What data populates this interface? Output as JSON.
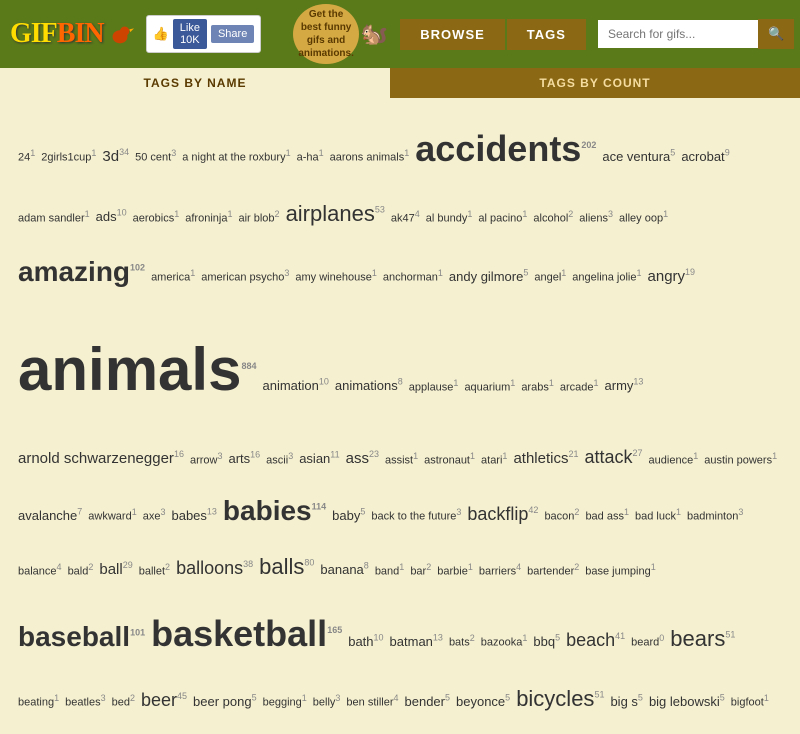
{
  "header": {
    "logo_gif": "GIF",
    "logo_bin": "BIN",
    "like_text": "Like 10K",
    "share_text": "Share",
    "banner_text": "Get the best funny gifs and animations.",
    "browse_label": "BROWSE",
    "tags_label": "TAGS",
    "search_placeholder": "Search for gifs..."
  },
  "tabs": {
    "by_name_label": "TAGS BY NAME",
    "by_count_label": "TAGS BY COUNT"
  },
  "tags": [
    {
      "text": "24",
      "count": "1",
      "size": 1
    },
    {
      "text": "2girls1cup",
      "count": "1",
      "size": 1
    },
    {
      "text": "3d",
      "count": "34",
      "size": 3
    },
    {
      "text": "50 cent",
      "count": "3",
      "size": 1
    },
    {
      "text": "a night at the roxbury",
      "count": "1",
      "size": 1
    },
    {
      "text": "a-ha",
      "count": "1",
      "size": 1
    },
    {
      "text": "aarons animals",
      "count": "1",
      "size": 1
    },
    {
      "text": "accidents",
      "count": "202",
      "size": 7
    },
    {
      "text": "ace ventura",
      "count": "5",
      "size": 2
    },
    {
      "text": "acrobat",
      "count": "9",
      "size": 2
    },
    {
      "text": "adam sandler",
      "count": "1",
      "size": 1
    },
    {
      "text": "ads",
      "count": "10",
      "size": 2
    },
    {
      "text": "aerobics",
      "count": "1",
      "size": 1
    },
    {
      "text": "afroninja",
      "count": "1",
      "size": 1
    },
    {
      "text": "air blob",
      "count": "2",
      "size": 1
    },
    {
      "text": "airplanes",
      "count": "53",
      "size": 5
    },
    {
      "text": "ak47",
      "count": "4",
      "size": 1
    },
    {
      "text": "al bundy",
      "count": "1",
      "size": 1
    },
    {
      "text": "al pacino",
      "count": "1",
      "size": 1
    },
    {
      "text": "alcohol",
      "count": "2",
      "size": 1
    },
    {
      "text": "aliens",
      "count": "3",
      "size": 1
    },
    {
      "text": "alley oop",
      "count": "1",
      "size": 1
    },
    {
      "text": "amazing",
      "count": "102",
      "size": 6
    },
    {
      "text": "america",
      "count": "1",
      "size": 1
    },
    {
      "text": "american psycho",
      "count": "3",
      "size": 1
    },
    {
      "text": "amy winehouse",
      "count": "1",
      "size": 1
    },
    {
      "text": "anchorman",
      "count": "1",
      "size": 1
    },
    {
      "text": "andy gilmore",
      "count": "5",
      "size": 2
    },
    {
      "text": "angel",
      "count": "1",
      "size": 1
    },
    {
      "text": "angelina jolie",
      "count": "1",
      "size": 1
    },
    {
      "text": "angry",
      "count": "19",
      "size": 3
    },
    {
      "text": "animals",
      "count": "884",
      "size": 9
    },
    {
      "text": "animation",
      "count": "10",
      "size": 2
    },
    {
      "text": "animations",
      "count": "8",
      "size": 2
    },
    {
      "text": "applause",
      "count": "1",
      "size": 1
    },
    {
      "text": "aquarium",
      "count": "1",
      "size": 1
    },
    {
      "text": "arabs",
      "count": "1",
      "size": 1
    },
    {
      "text": "arcade",
      "count": "1",
      "size": 1
    },
    {
      "text": "army",
      "count": "13",
      "size": 2
    },
    {
      "text": "arnold schwarzenegger",
      "count": "16",
      "size": 3
    },
    {
      "text": "arrow",
      "count": "3",
      "size": 1
    },
    {
      "text": "arts",
      "count": "16",
      "size": 2
    },
    {
      "text": "ascii",
      "count": "3",
      "size": 1
    },
    {
      "text": "asian",
      "count": "11",
      "size": 2
    },
    {
      "text": "ass",
      "count": "23",
      "size": 3
    },
    {
      "text": "assist",
      "count": "1",
      "size": 1
    },
    {
      "text": "astronaut",
      "count": "1",
      "size": 1
    },
    {
      "text": "atari",
      "count": "1",
      "size": 1
    },
    {
      "text": "athletics",
      "count": "21",
      "size": 3
    },
    {
      "text": "attack",
      "count": "27",
      "size": 4
    },
    {
      "text": "audience",
      "count": "1",
      "size": 1
    },
    {
      "text": "austin powers",
      "count": "1",
      "size": 1
    },
    {
      "text": "avalanche",
      "count": "7",
      "size": 2
    },
    {
      "text": "awkward",
      "count": "1",
      "size": 1
    },
    {
      "text": "axe",
      "count": "3",
      "size": 1
    },
    {
      "text": "babes",
      "count": "13",
      "size": 2
    },
    {
      "text": "babies",
      "count": "114",
      "size": 6
    },
    {
      "text": "baby",
      "count": "5",
      "size": 2
    },
    {
      "text": "back to the future",
      "count": "3",
      "size": 1
    },
    {
      "text": "backflip",
      "count": "42",
      "size": 4
    },
    {
      "text": "bacon",
      "count": "2",
      "size": 1
    },
    {
      "text": "bad ass",
      "count": "1",
      "size": 1
    },
    {
      "text": "bad luck",
      "count": "1",
      "size": 1
    },
    {
      "text": "badminton",
      "count": "3",
      "size": 1
    },
    {
      "text": "balance",
      "count": "4",
      "size": 1
    },
    {
      "text": "bald",
      "count": "2",
      "size": 1
    },
    {
      "text": "ball",
      "count": "29",
      "size": 3
    },
    {
      "text": "ballet",
      "count": "2",
      "size": 1
    },
    {
      "text": "balloons",
      "count": "38",
      "size": 4
    },
    {
      "text": "balls",
      "count": "80",
      "size": 5
    },
    {
      "text": "banana",
      "count": "8",
      "size": 2
    },
    {
      "text": "band",
      "count": "1",
      "size": 1
    },
    {
      "text": "bar",
      "count": "2",
      "size": 1
    },
    {
      "text": "barbie",
      "count": "1",
      "size": 1
    },
    {
      "text": "barriers",
      "count": "4",
      "size": 1
    },
    {
      "text": "bartender",
      "count": "2",
      "size": 1
    },
    {
      "text": "base jumping",
      "count": "1",
      "size": 1
    },
    {
      "text": "baseball",
      "count": "101",
      "size": 6
    },
    {
      "text": "basketball",
      "count": "165",
      "size": 7
    },
    {
      "text": "bath",
      "count": "10",
      "size": 2
    },
    {
      "text": "batman",
      "count": "13",
      "size": 2
    },
    {
      "text": "bats",
      "count": "2",
      "size": 1
    },
    {
      "text": "bazooka",
      "count": "1",
      "size": 1
    },
    {
      "text": "bbq",
      "count": "5",
      "size": 2
    },
    {
      "text": "beach",
      "count": "41",
      "size": 4
    },
    {
      "text": "beard",
      "count": "0",
      "size": 1
    },
    {
      "text": "bears",
      "count": "51",
      "size": 5
    },
    {
      "text": "beating",
      "count": "1",
      "size": 1
    },
    {
      "text": "beatles",
      "count": "3",
      "size": 1
    },
    {
      "text": "bed",
      "count": "2",
      "size": 1
    },
    {
      "text": "beer",
      "count": "45",
      "size": 4
    },
    {
      "text": "beer pong",
      "count": "5",
      "size": 2
    },
    {
      "text": "begging",
      "count": "1",
      "size": 1
    },
    {
      "text": "belly",
      "count": "3",
      "size": 1
    },
    {
      "text": "ben stiller",
      "count": "4",
      "size": 1
    },
    {
      "text": "bender",
      "count": "5",
      "size": 2
    },
    {
      "text": "beyonce",
      "count": "5",
      "size": 2
    },
    {
      "text": "bicycles",
      "count": "51",
      "size": 5
    },
    {
      "text": "big s",
      "count": "5",
      "size": 2
    },
    {
      "text": "big lebowski",
      "count": "5",
      "size": 2
    },
    {
      "text": "bigfoot",
      "count": "1",
      "size": 1
    }
  ]
}
